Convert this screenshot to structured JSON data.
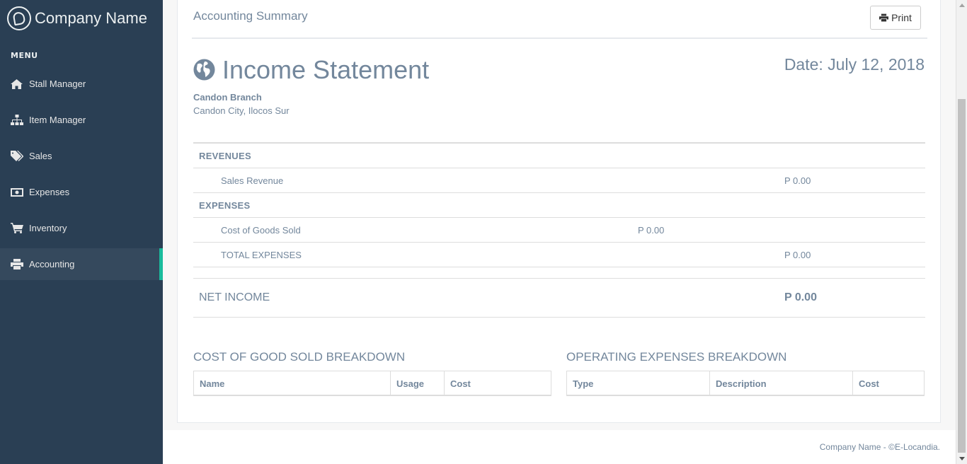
{
  "brand": {
    "name": "Company Name"
  },
  "sidebar": {
    "menu_title": "MENU",
    "items": [
      {
        "label": "Stall Manager",
        "icon": "home-icon"
      },
      {
        "label": "Item Manager",
        "icon": "sitemap-icon"
      },
      {
        "label": "Sales",
        "icon": "tags-icon"
      },
      {
        "label": "Expenses",
        "icon": "money-icon"
      },
      {
        "label": "Inventory",
        "icon": "cart-icon"
      },
      {
        "label": "Accounting",
        "icon": "print-icon",
        "active": true
      }
    ]
  },
  "header": {
    "title": "Accounting Summary",
    "print_label": "Print"
  },
  "statement": {
    "title": "Income Statement",
    "date": "Date: July 12, 2018",
    "branch": "Candon Branch",
    "address": "Candon City, Ilocos Sur",
    "revenues_label": "REVENUES",
    "sales_revenue_label": "Sales Revenue",
    "sales_revenue_value": "P 0.00",
    "expenses_label": "EXPENSES",
    "cogs_label": "Cost of Goods Sold",
    "cogs_value": "P 0.00",
    "total_expenses_label": "TOTAL EXPENSES",
    "total_expenses_value": "P 0.00",
    "net_income_label": "NET INCOME",
    "net_income_value": "P 0.00"
  },
  "cogs_breakdown": {
    "title": "COST OF GOOD SOLD BREAKDOWN",
    "columns": [
      "Name",
      "Usage",
      "Cost"
    ]
  },
  "opex_breakdown": {
    "title": "OPERATING EXPENSES BREAKDOWN",
    "columns": [
      "Type",
      "Description",
      "Cost"
    ]
  },
  "footer": {
    "text": "Company Name - ©E-Locandia."
  }
}
